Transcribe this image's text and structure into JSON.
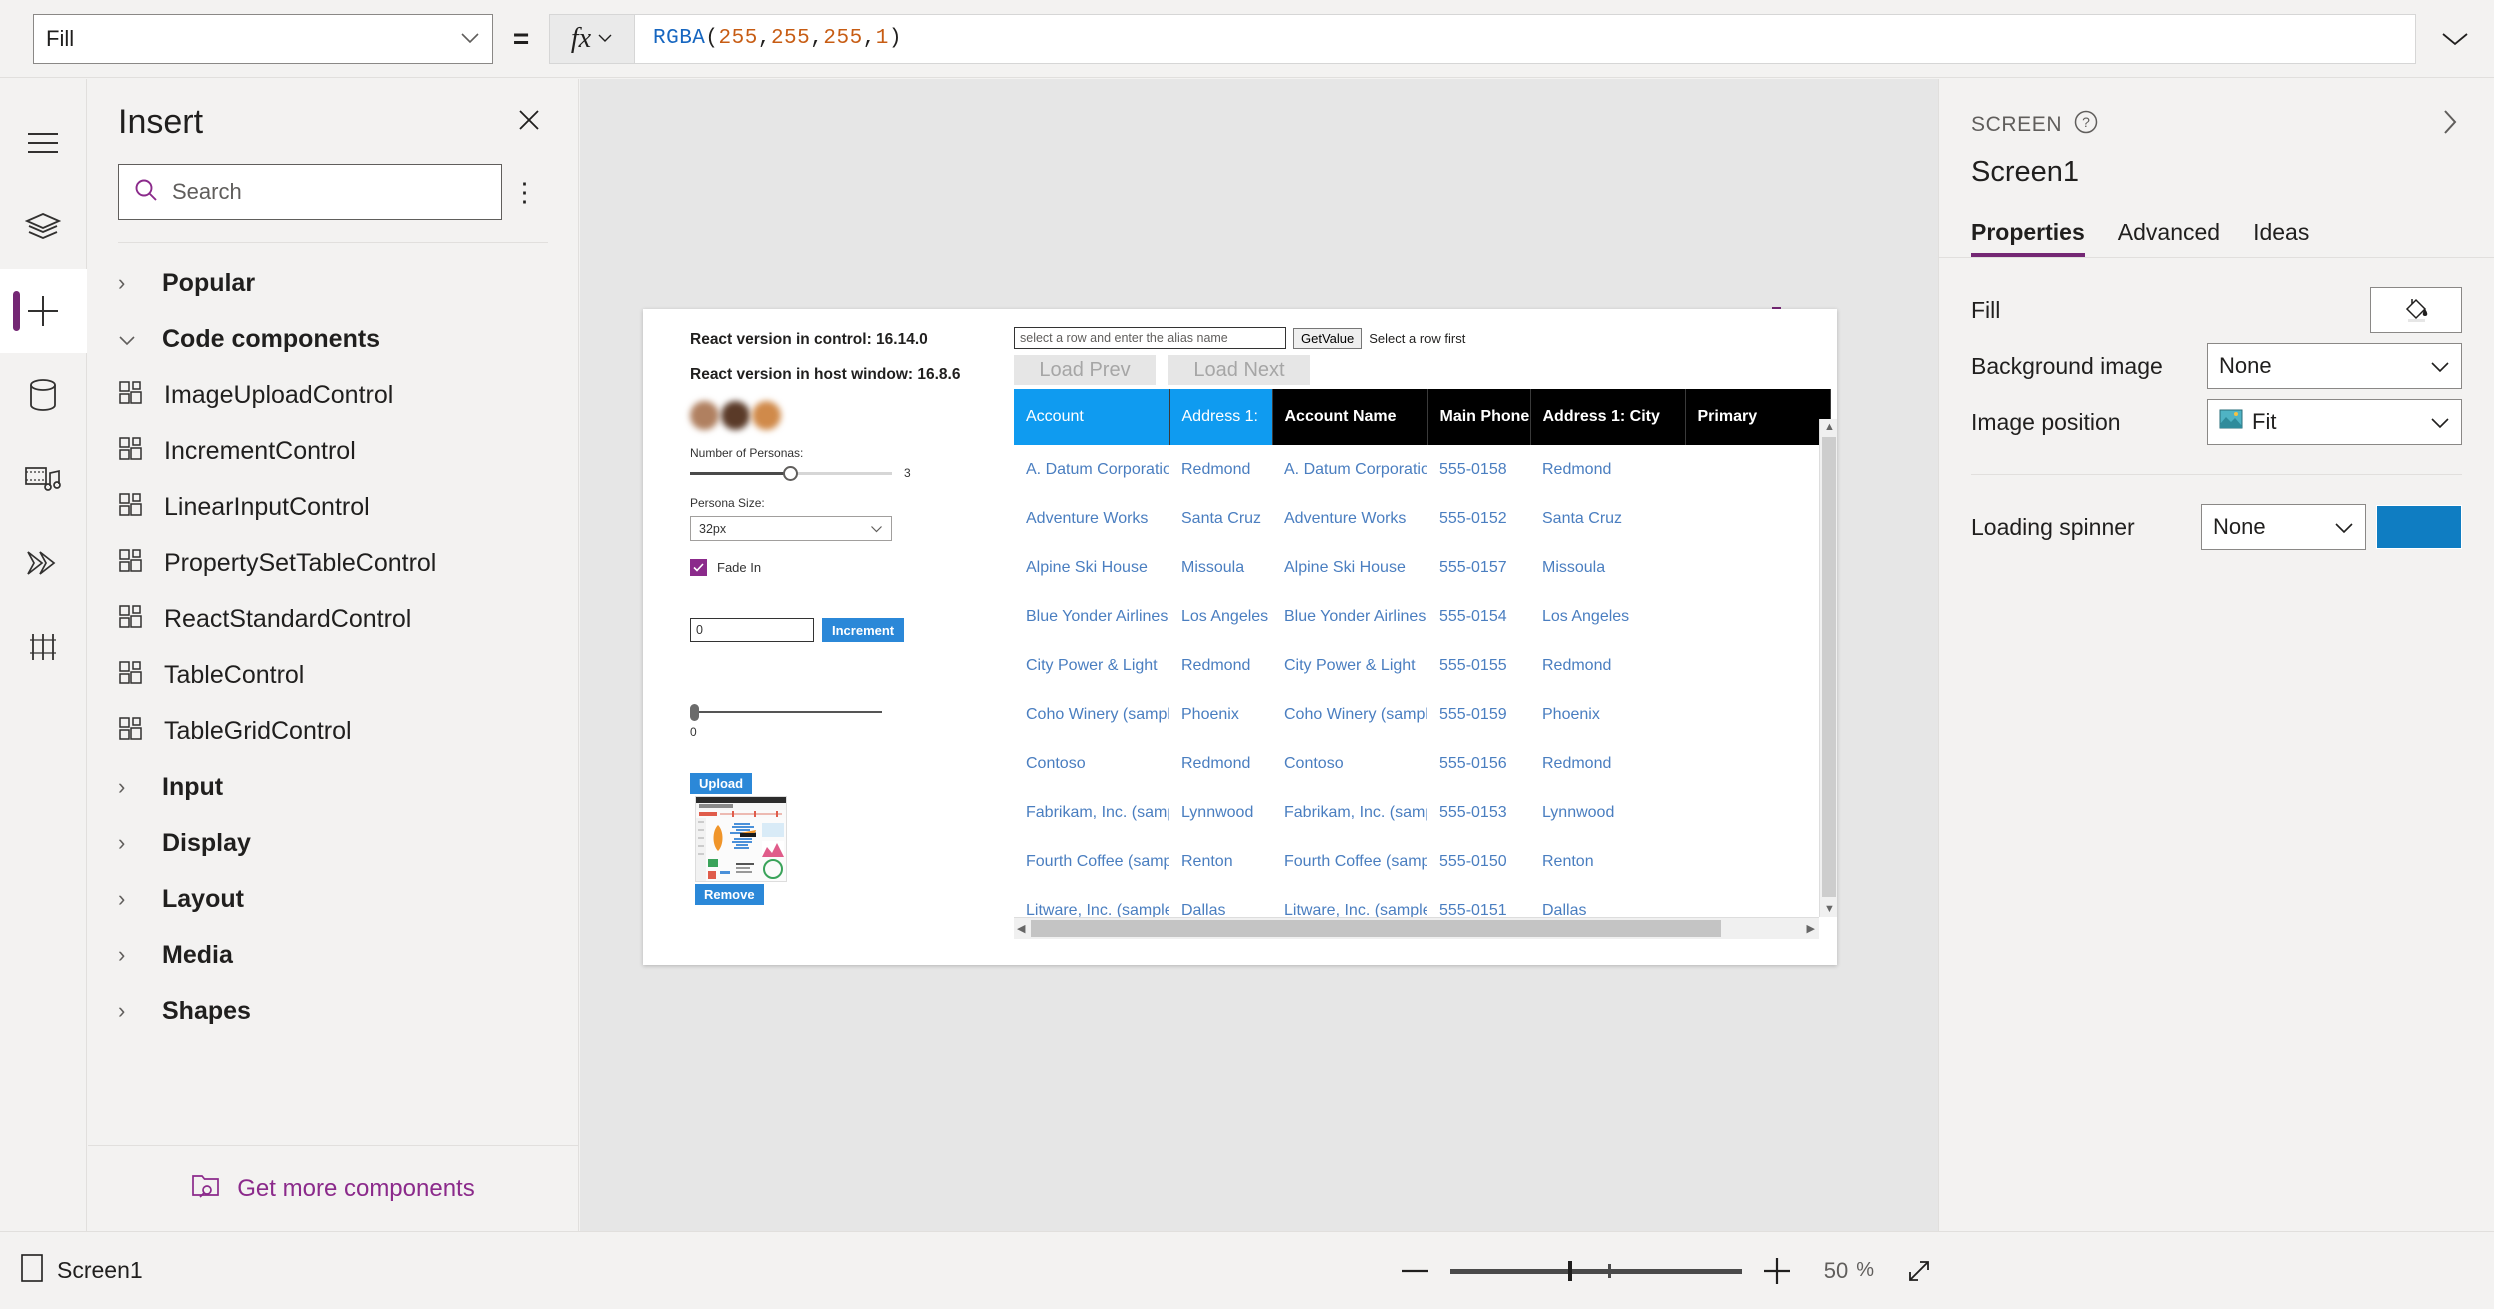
{
  "formula_bar": {
    "property_name": "Fill",
    "equals": "=",
    "fx_label": "fx",
    "formula": "RGBA(255, 255, 255, 1)",
    "formula_parts": {
      "fn": "RGBA",
      "open": "(",
      "a1": "255",
      "c1": ", ",
      "a2": "255",
      "c2": ", ",
      "a3": "255",
      "c3": ", ",
      "a4": "1",
      "close": ")"
    }
  },
  "rail": {
    "items": [
      {
        "name": "hamburger-menu",
        "icon": "hamburger-icon"
      },
      {
        "name": "tree-view",
        "icon": "layers-icon"
      },
      {
        "name": "insert",
        "icon": "plus-icon"
      },
      {
        "name": "data",
        "icon": "database-icon"
      },
      {
        "name": "media",
        "icon": "media-icon"
      },
      {
        "name": "power-automate",
        "icon": "power-automate-icon"
      },
      {
        "name": "variables",
        "icon": "variables-icon"
      }
    ]
  },
  "insert_panel": {
    "title": "Insert",
    "close_label": "✕",
    "search_placeholder": "Search",
    "more_label": "⋮",
    "categories_top": [
      {
        "label": "Popular",
        "expanded": false
      }
    ],
    "code_components_label": "Code components",
    "code_components": [
      "ImageUploadControl",
      "IncrementControl",
      "LinearInputControl",
      "PropertySetTableControl",
      "ReactStandardControl",
      "TableControl",
      "TableGridControl"
    ],
    "categories_bottom": [
      {
        "label": "Input",
        "expanded": false
      },
      {
        "label": "Display",
        "expanded": false
      },
      {
        "label": "Layout",
        "expanded": false
      },
      {
        "label": "Media",
        "expanded": false
      },
      {
        "label": "Shapes",
        "expanded": false
      }
    ],
    "footer_label": "Get more components"
  },
  "canvas": {
    "react_version_control": "React version in control: 16.14.0",
    "react_version_host": "React version in host window: 16.8.6",
    "persona_count_label": "Number of Personas:",
    "persona_count_value": "3",
    "persona_size_label": "Persona Size:",
    "persona_size_value": "32px",
    "fade_in_label": "Fade In",
    "fade_in_checked": true,
    "increment_value": "0",
    "increment_button": "Increment",
    "linear_value": "0",
    "upload_button": "Upload",
    "remove_button": "Remove"
  },
  "table_control": {
    "alias_placeholder": "select a row and enter the alias name",
    "get_value_button": "GetValue",
    "status_text": "Select a row first",
    "load_prev": "Load Prev",
    "load_next": "Load Next",
    "columns": [
      {
        "label": "Account",
        "highlight": true
      },
      {
        "label": "Address 1:",
        "highlight": true
      },
      {
        "label": "Account Name",
        "highlight": false
      },
      {
        "label": "Main Phone",
        "highlight": false
      },
      {
        "label": "Address 1: City",
        "highlight": false
      },
      {
        "label": "Primary",
        "highlight": false
      }
    ],
    "rows": [
      [
        "A. Datum Corporation",
        "Redmond",
        "A. Datum Corporation",
        "555-0158",
        "Redmond",
        ""
      ],
      [
        "Adventure Works",
        "Santa Cruz",
        "Adventure Works",
        "555-0152",
        "Santa Cruz",
        ""
      ],
      [
        "Alpine Ski House",
        "Missoula",
        "Alpine Ski House",
        "555-0157",
        "Missoula",
        ""
      ],
      [
        "Blue Yonder Airlines",
        "Los Angeles",
        "Blue Yonder Airlines",
        "555-0154",
        "Los Angeles",
        ""
      ],
      [
        "City Power & Light",
        "Redmond",
        "City Power & Light",
        "555-0155",
        "Redmond",
        ""
      ],
      [
        "Coho Winery (sample)",
        "Phoenix",
        "Coho Winery (sample)",
        "555-0159",
        "Phoenix",
        ""
      ],
      [
        "Contoso",
        "Redmond",
        "Contoso",
        "555-0156",
        "Redmond",
        ""
      ],
      [
        "Fabrikam, Inc. (sample)",
        "Lynnwood",
        "Fabrikam, Inc. (sample)",
        "555-0153",
        "Lynnwood",
        ""
      ],
      [
        "Fourth Coffee (sample)",
        "Renton",
        "Fourth Coffee (sample)",
        "555-0150",
        "Renton",
        ""
      ],
      [
        "Litware, Inc. (sample)",
        "Dallas",
        "Litware, Inc. (sample)",
        "555-0151",
        "Dallas",
        ""
      ]
    ]
  },
  "properties": {
    "kind": "SCREEN",
    "name": "Screen1",
    "tabs": [
      {
        "label": "Properties",
        "active": true
      },
      {
        "label": "Advanced",
        "active": false
      },
      {
        "label": "Ideas",
        "active": false
      }
    ],
    "fill_label": "Fill",
    "background_image_label": "Background image",
    "background_image_value": "None",
    "image_position_label": "Image position",
    "image_position_value": "Fit",
    "loading_spinner_label": "Loading spinner",
    "loading_spinner_value": "None",
    "loading_spinner_color": "#0f7dc2"
  },
  "status_bar": {
    "screen_name": "Screen1",
    "zoom_minus": "−",
    "zoom_plus": "+",
    "zoom_percent": "50",
    "zoom_unit": "%"
  },
  "colors": {
    "accent": "#742774",
    "link_purple": "#8b2a8b",
    "header_highlight": "#0f9bf0",
    "header_dark": "#000000",
    "cell_text": "#4a7ec0",
    "button_blue": "#2b88d8"
  }
}
